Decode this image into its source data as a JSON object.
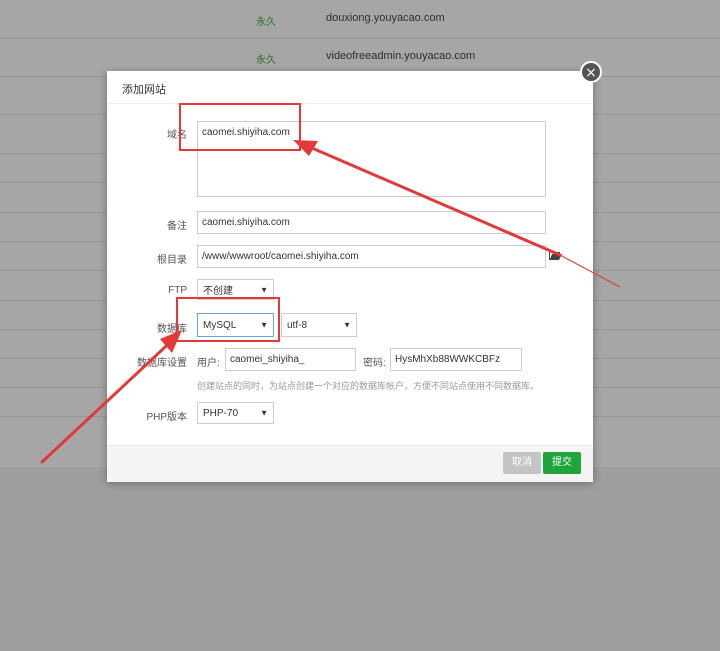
{
  "background": {
    "rows": [
      {
        "status": "永久",
        "domain": "douxiong.youyacao.com"
      },
      {
        "status": "永久",
        "domain": "videofreeadmin.youyacao.com"
      }
    ]
  },
  "dialog": {
    "title": "添加网站",
    "close_icon": "×",
    "domain": {
      "label": "域名",
      "value": "caomei.shiyiha.com"
    },
    "remark": {
      "label": "备注",
      "value": "caomei.shiyiha.com"
    },
    "root": {
      "label": "根目录",
      "value": "/www/wwwroot/caomei.shiyiha.com"
    },
    "ftp": {
      "label": "FTP",
      "value": "不创建"
    },
    "database": {
      "label": "数据库",
      "value": "MySQL",
      "charset": "utf-8"
    },
    "db_settings": {
      "label": "数据库设置",
      "user_label": "用户:",
      "user_value": "caomei_shiyiha_",
      "password_label": "密码:",
      "password_value": "HysMhXb88WWKCBFz",
      "help": "创建站点的同时，为站点创建一个对应的数据库帐户，方便不同站点使用不同数据库。"
    },
    "php": {
      "label": "PHP版本",
      "value": "PHP-70"
    },
    "cancel_label": "取消",
    "submit_label": "提交"
  },
  "colors": {
    "annotation_red": "#e23a3a",
    "submit_green": "#20a53a"
  }
}
